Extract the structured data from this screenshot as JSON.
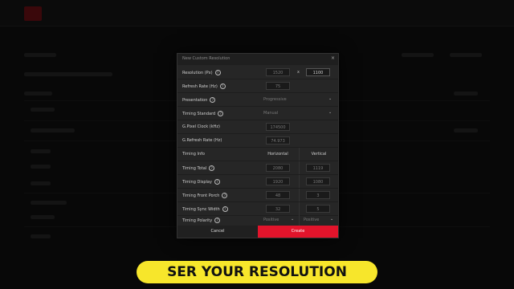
{
  "dialog": {
    "title": "New Custom Resolution",
    "close_icon": "×",
    "resolution": {
      "label": "Resolution (Px)",
      "width": "1520",
      "sep": "x",
      "height": "1100"
    },
    "refresh": {
      "label": "Refresh Rate (Hz)",
      "value": "75"
    },
    "presentation": {
      "label": "Presentation",
      "value": "Progressive"
    },
    "timing_standard": {
      "label": "Timing Standard",
      "value": "Manual"
    },
    "pixel_clock": {
      "label": "G.Pixel Clock (kHz)",
      "value": "174500"
    },
    "g_refresh": {
      "label": "G.Refresh Rate (Hz)",
      "value": "74.973"
    },
    "timing_info": {
      "label": "Timing Info",
      "horizontal": "Horizontal",
      "vertical": "Vertical"
    },
    "timing_total": {
      "label": "Timing Total",
      "h": "2080",
      "v": "1119"
    },
    "timing_display": {
      "label": "Timing Display",
      "h": "1920",
      "v": "1080"
    },
    "timing_front_porch": {
      "label": "Timing Front Porch",
      "h": "48",
      "v": "3"
    },
    "timing_sync_width": {
      "label": "Timing Sync Width",
      "h": "32",
      "v": "5"
    },
    "timing_polarity": {
      "label": "Timing Polarity",
      "h": "Positive",
      "v": "Positive"
    },
    "cancel_label": "Cancel",
    "create_label": "Create"
  },
  "caption": "SER YOUR RESOLUTION",
  "colors": {
    "accent": "#e2142b",
    "caption_bg": "#f7e62b"
  }
}
